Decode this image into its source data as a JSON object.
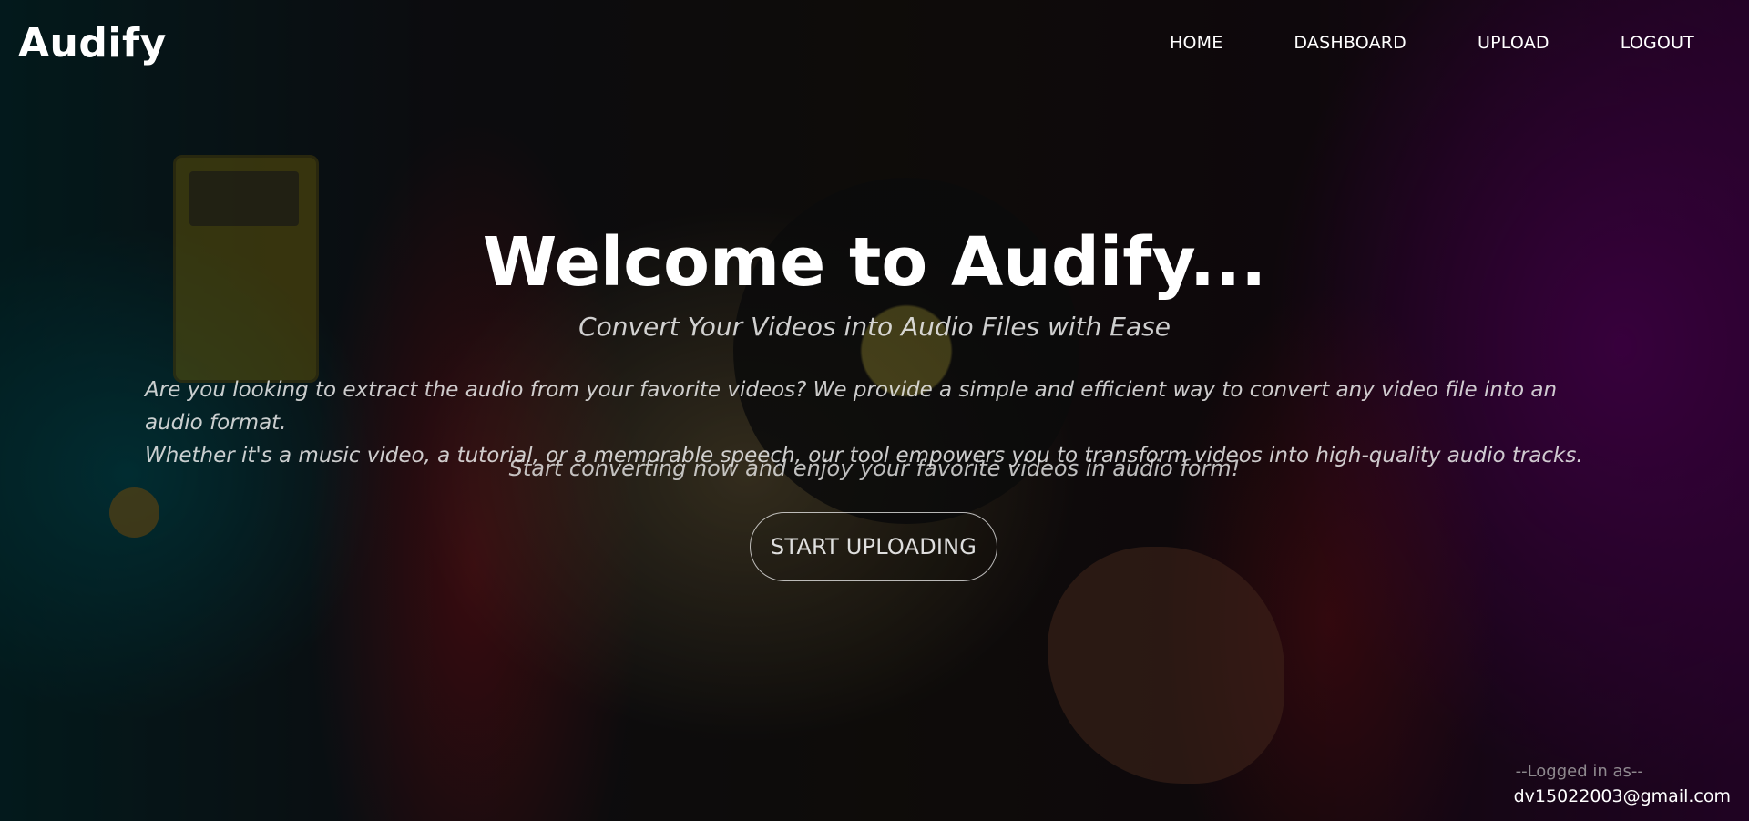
{
  "app": {
    "name": "Audify"
  },
  "nav": {
    "items": [
      {
        "label": "HOME"
      },
      {
        "label": "DASHBOARD"
      },
      {
        "label": "UPLOAD"
      },
      {
        "label": "LOGOUT"
      }
    ]
  },
  "hero": {
    "title": "Welcome to Audify...",
    "subtitle": "Convert Your Videos into Audio Files with Ease",
    "description_lines": [
      "Are you looking to extract the audio from your favorite videos? We provide a simple and efficient way to convert any video file into an audio format.",
      "Whether it's a music video, a tutorial, or a memorable speech, our tool empowers you to transform videos into high-quality audio tracks."
    ],
    "cta_text": "Start converting now and enjoy your favorite videos in audio form!",
    "cta_button_label": "START UPLOADING"
  },
  "footer": {
    "logged_in_label": "--Logged in as--",
    "email": "dv15022003@gmail.com"
  }
}
